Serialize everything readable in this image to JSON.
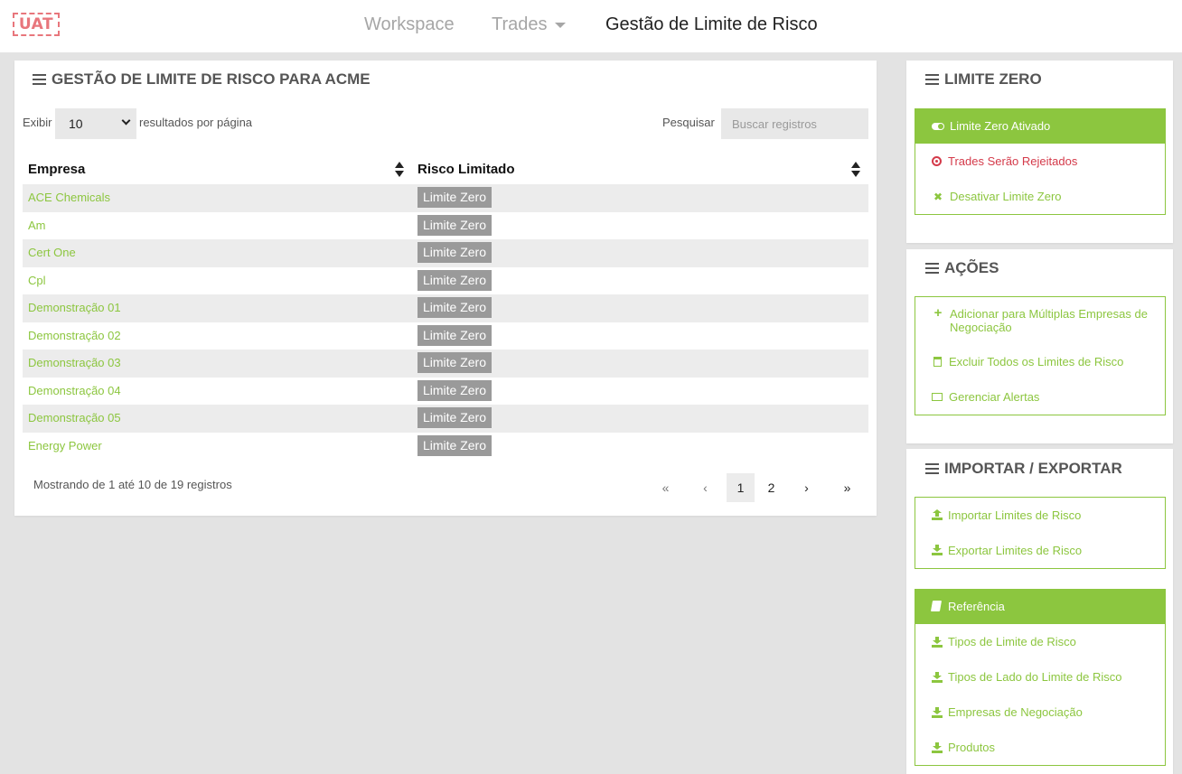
{
  "logo": "UAT",
  "nav": {
    "workspace": "Workspace",
    "trades": "Trades",
    "current": "Gestão de Limite de Risco"
  },
  "main": {
    "title": "GESTÃO DE LIMITE DE RISCO PARA ACME",
    "show_label": "Exibir",
    "page_size": "10",
    "per_page_label": "resultados por página",
    "search_label": "Pesquisar",
    "search_placeholder": "Buscar registros",
    "columns": [
      "Empresa",
      "Risco Limitado"
    ],
    "rows": [
      {
        "company": "ACE Chemicals",
        "risk": "Limite Zero"
      },
      {
        "company": "Am",
        "risk": "Limite Zero"
      },
      {
        "company": "Cert One",
        "risk": "Limite Zero"
      },
      {
        "company": "Cpl",
        "risk": "Limite Zero"
      },
      {
        "company": "Demonstração 01",
        "risk": "Limite Zero"
      },
      {
        "company": "Demonstração 02",
        "risk": "Limite Zero"
      },
      {
        "company": "Demonstração 03",
        "risk": "Limite Zero"
      },
      {
        "company": "Demonstração 04",
        "risk": "Limite Zero"
      },
      {
        "company": "Demonstração 05",
        "risk": "Limite Zero"
      },
      {
        "company": "Energy Power",
        "risk": "Limite Zero"
      }
    ],
    "showing": "Mostrando de 1 até 10 de 19 registros",
    "pagination": {
      "first": "«",
      "prev": "‹",
      "pages": [
        "1",
        "2"
      ],
      "current_page": "1",
      "next": "›",
      "last": "»"
    }
  },
  "limit_zero": {
    "title": "LIMITE ZERO",
    "status": "Limite Zero Ativado",
    "rejected": "Trades Serão Rejeitados",
    "deactivate": "Desativar Limite Zero"
  },
  "actions": {
    "title": "AÇÕES",
    "add_multiple": "Adicionar para Múltiplas Empresas de Negociação",
    "delete_all": "Excluir Todos os Limites de Risco",
    "manage_alerts": "Gerenciar Alertas"
  },
  "import_export": {
    "title": "IMPORTAR / EXPORTAR",
    "import": "Importar Limites de Risco",
    "export": "Exportar Limites de Risco",
    "reference": "Referência",
    "ref_items": [
      "Tipos de Limite de Risco",
      "Tipos de Lado do Limite de Risco",
      "Empresas de Negociação",
      "Produtos"
    ]
  },
  "colors": {
    "accent": "#8cc63f",
    "badge": "#9a9a9a",
    "danger": "#d43a4a",
    "logo": "#e8767c",
    "background": "#e3e3e3"
  }
}
